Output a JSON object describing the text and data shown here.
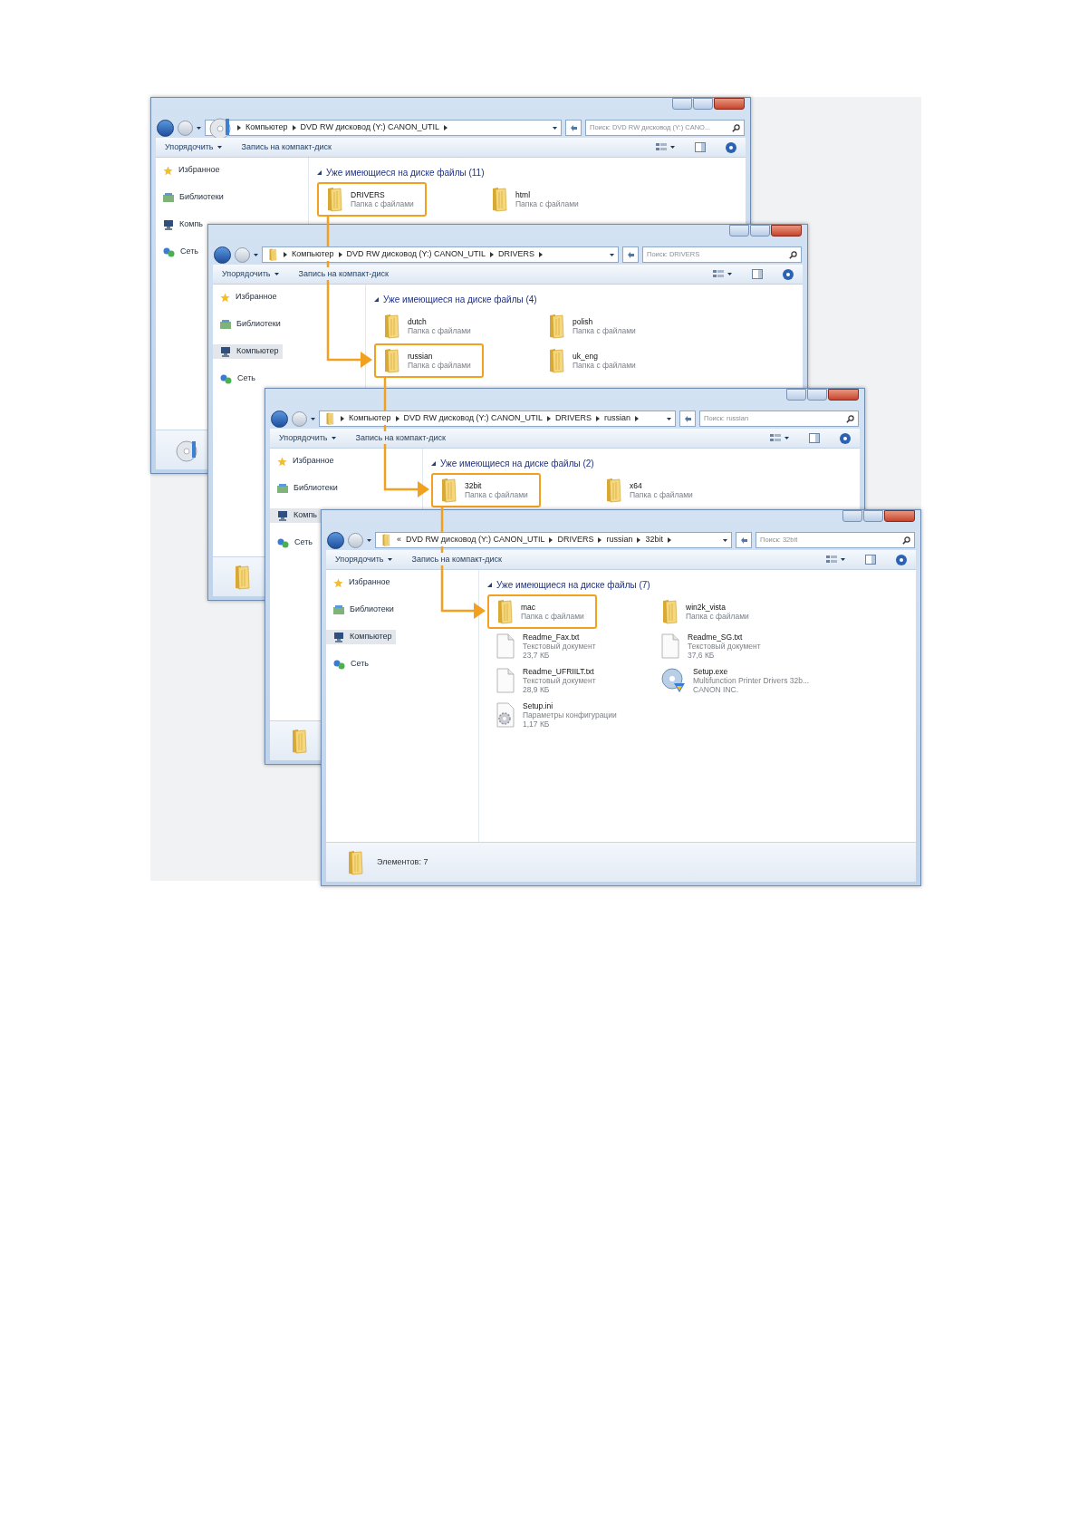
{
  "windows": [
    {
      "breadcrumb": [
        "Компьютер",
        "DVD RW дисковод (Y:) CANON_UTIL"
      ],
      "search_placeholder": "Поиск: DVD RW дисковод (Y:) CANO...",
      "toolbar": [
        "Упорядочить",
        "Запись на компакт-диск"
      ],
      "sidebar": [
        {
          "label": "Избранное",
          "kind": "star",
          "selected": false
        },
        {
          "label": "Библиотеки",
          "kind": "library",
          "selected": false
        },
        {
          "label": "Компь",
          "kind": "computer",
          "selected": false
        },
        {
          "label": "Сеть",
          "kind": "network",
          "selected": false
        }
      ],
      "group_header": "Уже имеющиеся на диске файлы (11)",
      "items": [
        {
          "name": "DRIVERS",
          "kind": "folder",
          "details": [
            "Папка с файлами"
          ],
          "highlighted": true
        },
        {
          "name": "html",
          "kind": "folder",
          "details": [
            "Папка с файлами"
          ],
          "highlighted": false
        }
      ]
    },
    {
      "breadcrumb": [
        "Компьютер",
        "DVD RW дисковод (Y:) CANON_UTIL",
        "DRIVERS"
      ],
      "search_placeholder": "Поиск: DRIVERS",
      "toolbar": [
        "Упорядочить",
        "Запись на компакт-диск"
      ],
      "sidebar": [
        {
          "label": "Избранное",
          "kind": "star",
          "selected": false
        },
        {
          "label": "Библиотеки",
          "kind": "library",
          "selected": false
        },
        {
          "label": "Компьютер",
          "kind": "computer",
          "selected": true
        },
        {
          "label": "Сеть",
          "kind": "network",
          "selected": false
        }
      ],
      "group_header": "Уже имеющиеся на диске файлы (4)",
      "items": [
        {
          "name": "dutch",
          "kind": "folder",
          "details": [
            "Папка с файлами"
          ],
          "highlighted": false
        },
        {
          "name": "polish",
          "kind": "folder",
          "details": [
            "Папка с файлами"
          ],
          "highlighted": false
        },
        {
          "name": "russian",
          "kind": "folder",
          "details": [
            "Папка с файлами"
          ],
          "highlighted": true
        },
        {
          "name": "uk_eng",
          "kind": "folder",
          "details": [
            "Папка с файлами"
          ],
          "highlighted": false
        }
      ]
    },
    {
      "breadcrumb": [
        "Компьютер",
        "DVD RW дисковод (Y:) CANON_UTIL",
        "DRIVERS",
        "russian"
      ],
      "search_placeholder": "Поиск: russian",
      "toolbar": [
        "Упорядочить",
        "Запись на компакт-диск"
      ],
      "sidebar": [
        {
          "label": "Избранное",
          "kind": "star",
          "selected": false
        },
        {
          "label": "Библиотеки",
          "kind": "library",
          "selected": false
        },
        {
          "label": "Компь",
          "kind": "computer",
          "selected": true
        },
        {
          "label": "Сеть",
          "kind": "network",
          "selected": false
        }
      ],
      "group_header": "Уже имеющиеся на диске файлы (2)",
      "items": [
        {
          "name": "32bit",
          "kind": "folder",
          "details": [
            "Папка с файлами"
          ],
          "highlighted": true
        },
        {
          "name": "x64",
          "kind": "folder",
          "details": [
            "Папка с файлами"
          ],
          "highlighted": false
        }
      ]
    },
    {
      "breadcrumb_prefix": "«",
      "breadcrumb": [
        "DVD RW дисковод (Y:) CANON_UTIL",
        "DRIVERS",
        "russian",
        "32bit"
      ],
      "search_placeholder": "Поиск: 32bit",
      "toolbar": [
        "Упорядочить",
        "Запись на компакт-диск"
      ],
      "sidebar": [
        {
          "label": "Избранное",
          "kind": "star",
          "selected": false
        },
        {
          "label": "Библиотеки",
          "kind": "library",
          "selected": false
        },
        {
          "label": "Компьютер",
          "kind": "computer",
          "selected": true
        },
        {
          "label": "Сеть",
          "kind": "network",
          "selected": false
        }
      ],
      "group_header": "Уже имеющиеся на диске файлы (7)",
      "items": [
        {
          "name": "mac",
          "kind": "folder",
          "details": [
            "Папка с файлами"
          ],
          "highlighted": true
        },
        {
          "name": "win2k_vista",
          "kind": "folder",
          "details": [
            "Папка с файлами"
          ],
          "highlighted": false
        },
        {
          "name": "Readme_Fax.txt",
          "kind": "text",
          "details": [
            "Текстовый документ",
            "23,7 КБ"
          ],
          "highlighted": false
        },
        {
          "name": "Readme_SG.txt",
          "kind": "text",
          "details": [
            "Текстовый документ",
            "37,6 КБ"
          ],
          "highlighted": false
        },
        {
          "name": "Readme_UFRIILT.txt",
          "kind": "text",
          "details": [
            "Текстовый документ",
            "28,9 КБ"
          ],
          "highlighted": false
        },
        {
          "name": "Setup.exe",
          "kind": "setup",
          "details": [
            "Multifunction Printer Drivers 32b...",
            "CANON INC."
          ],
          "highlighted": false
        },
        {
          "name": "Setup.ini",
          "kind": "config",
          "details": [
            "Параметры конфигурации",
            "1,17 КБ"
          ],
          "highlighted": false
        }
      ],
      "status": {
        "text": "Элементов: 7"
      }
    }
  ]
}
